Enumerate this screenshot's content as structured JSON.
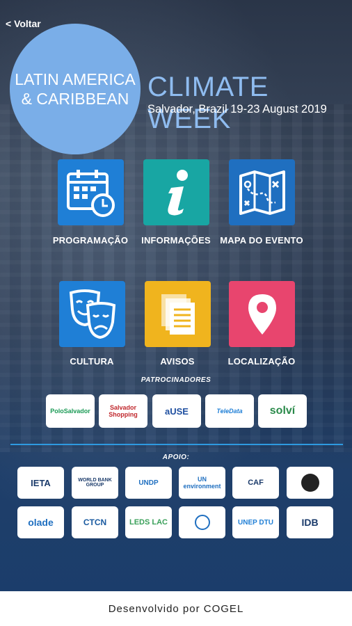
{
  "nav": {
    "back_label": "< Voltar"
  },
  "header": {
    "circle_line1": "LATIN AMERICA",
    "circle_line2": "& CARIBBEAN",
    "title": "CLIMATE WEEK",
    "subtitle": "Salvador, Brazil 19-23 August 2019"
  },
  "menu": [
    {
      "label": "PROGRAMAÇÃO",
      "color": "#1f7fd6",
      "icon": "calendar-clock-icon"
    },
    {
      "label": "INFORMAÇÕES",
      "color": "#18a6a3",
      "icon": "info-icon"
    },
    {
      "label": "MAPA DO EVENTO",
      "color": "#1f6fc0",
      "icon": "map-icon"
    },
    {
      "label": "CULTURA",
      "color": "#1f7fd6",
      "icon": "theater-masks-icon"
    },
    {
      "label": "AVISOS",
      "color": "#f0b41e",
      "icon": "documents-icon"
    },
    {
      "label": "LOCALIZAÇÃO",
      "color": "#e8456e",
      "icon": "location-pin-icon"
    }
  ],
  "sponsors": {
    "title": "PATROCINADORES",
    "items": [
      "PoloSalvador",
      "Salvador Shopping",
      "aUSE",
      "TeleData",
      "solví"
    ]
  },
  "support": {
    "title": "APOIO:",
    "items": [
      "IETA",
      "WORLD BANK GROUP",
      "UNDP",
      "UN environment",
      "CAF",
      "",
      "olade",
      "CTCN",
      "LEDS LAC",
      "",
      "UNEP DTU",
      "IDB"
    ]
  },
  "footer": {
    "text": "Desenvolvido por COGEL"
  }
}
